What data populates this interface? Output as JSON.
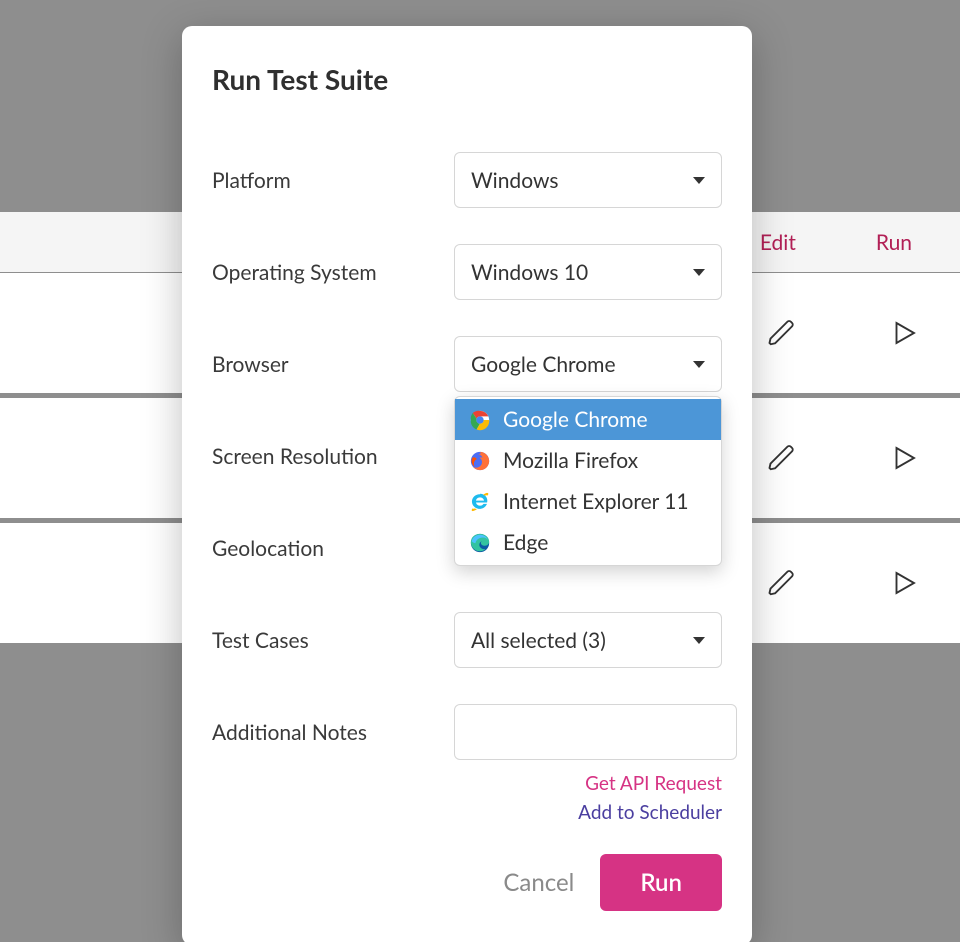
{
  "background": {
    "header": {
      "edit": "Edit",
      "run": "Run"
    }
  },
  "modal": {
    "title": "Run Test Suite",
    "fields": {
      "platform": {
        "label": "Platform",
        "value": "Windows"
      },
      "os": {
        "label": "Operating System",
        "value": "Windows 10"
      },
      "browser": {
        "label": "Browser",
        "value": "Google Chrome",
        "options": [
          "Google Chrome",
          "Mozilla Firefox",
          "Internet Explorer 11",
          "Edge"
        ],
        "selected_index": 0
      },
      "resolution": {
        "label": "Screen Resolution"
      },
      "geolocation": {
        "label": "Geolocation"
      },
      "testcases": {
        "label": "Test Cases",
        "value": "All selected (3)"
      },
      "notes": {
        "label": "Additional Notes",
        "value": ""
      }
    },
    "links": {
      "api": "Get API Request",
      "scheduler": "Add to Scheduler"
    },
    "buttons": {
      "cancel": "Cancel",
      "run": "Run"
    }
  }
}
